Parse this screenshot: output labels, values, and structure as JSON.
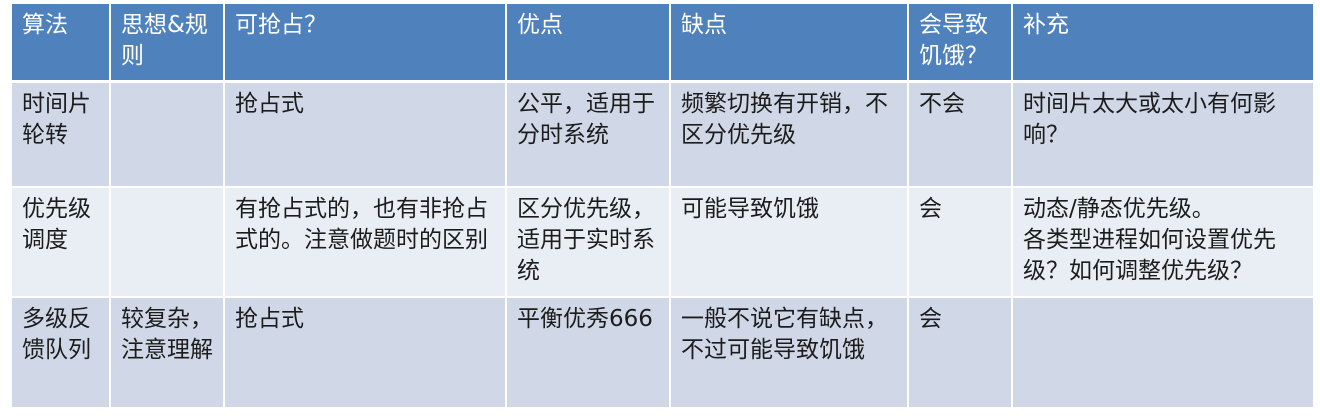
{
  "headers": [
    "算法",
    "思想&规则",
    "可抢占？",
    "优点",
    "缺点",
    "会导致饥饿？",
    "补充"
  ],
  "rows": [
    [
      "时间片轮转",
      "",
      "抢占式",
      "公平，适用于分时系统",
      "频繁切换有开销，不区分优先级",
      "不会",
      "时间片太大或太小有何影响？"
    ],
    [
      "优先级调度",
      "",
      "有抢占式的，也有非抢占式的。注意做题时的区别",
      "区分优先级，适用于实时系统",
      "可能导致饥饿",
      "会",
      "动态/静态优先级。\n各类型进程如何设置优先级？如何调整优先级？"
    ],
    [
      "多级反馈队列",
      "较复杂，注意理解",
      "抢占式",
      "平衡优秀666",
      "一般不说它有缺点，不过可能导致饥饿",
      "会",
      ""
    ]
  ],
  "colors": {
    "header_bg": "#4f81bd",
    "row_odd_bg": "#d0d8e8",
    "row_even_bg": "#e9edf4",
    "header_text": "#ffffff"
  }
}
